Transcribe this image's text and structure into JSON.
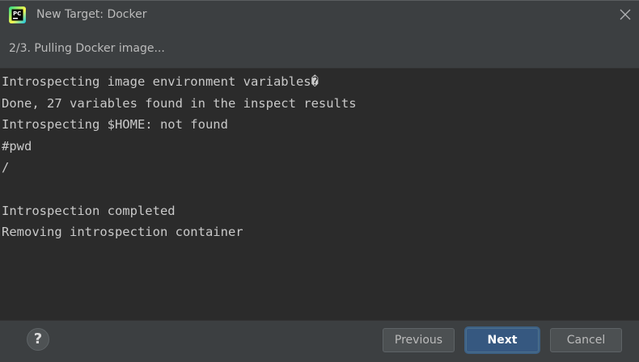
{
  "window": {
    "title": "New Target: Docker",
    "app_icon_text": "PC"
  },
  "wizard": {
    "step_text": "2/3. Pulling Docker image..."
  },
  "console": {
    "lines": [
      "Introspecting image environment variables�",
      "Done, 27 variables found in the inspect results",
      "Introspecting $HOME: not found",
      "#pwd",
      "/",
      "",
      "Introspection completed",
      "Removing introspection container"
    ]
  },
  "footer": {
    "help_label": "?",
    "previous_label": "Previous",
    "next_label": "Next",
    "cancel_label": "Cancel"
  },
  "colors": {
    "dialog_bg": "#3c3f41",
    "console_bg": "#2b2b2b",
    "console_text": "#c9c9c9",
    "primary_button": "#365880",
    "icon_green": "#21d789",
    "icon_yellow": "#fcf84a"
  }
}
